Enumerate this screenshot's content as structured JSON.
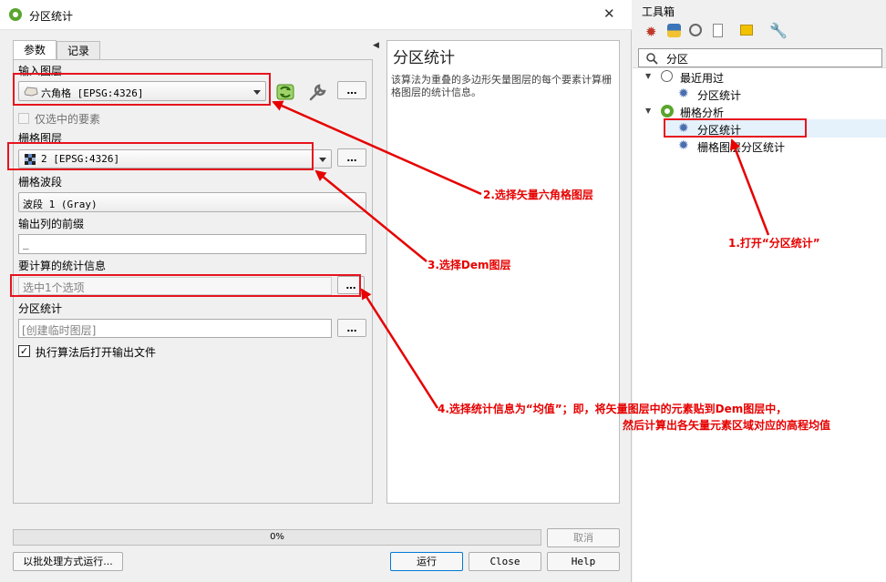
{
  "dialog": {
    "title": "分区统计",
    "close_glyph": "✕",
    "tabs": [
      {
        "label": "参数",
        "active": true
      },
      {
        "label": "记录",
        "active": false
      }
    ],
    "params": {
      "input_layer_label": "输入图层",
      "input_layer_value": "六角格 [EPSG:4326]",
      "selected_only_label": "仅选中的要素",
      "selected_only_checked": false,
      "raster_layer_label": "栅格图层",
      "raster_layer_value": "2 [EPSG:4326]",
      "raster_band_label": "栅格波段",
      "raster_band_value": "波段 1 (Gray)",
      "prefix_label": "输出列的前缀",
      "prefix_value": "_",
      "stats_label": "要计算的统计信息",
      "stats_placeholder": "选中1个选项",
      "zonal_label": "分区统计",
      "zonal_placeholder": "[创建临时图层]",
      "open_after_label": "执行算法后打开输出文件",
      "open_after_checked": true,
      "more_glyph": "…"
    },
    "help": {
      "title": "分区统计",
      "text": "该算法为重叠的多边形矢量图层的每个要素计算栅格图层的统计信息。"
    },
    "progress": {
      "value": 0,
      "text": "0%"
    },
    "buttons": {
      "cancel": "取消",
      "batch": "以批处理方式运行...",
      "run": "运行",
      "close": "Close",
      "help": "Help"
    }
  },
  "annotations": {
    "step1": "1.打开“分区统计”",
    "step2": "2.选择矢量六角格图层",
    "step3": "3.选择Dem图层",
    "step4_line1": "4.选择统计信息为“均值”；即，将矢量图层中的元素贴到Dem图层中，",
    "step4_line2": "然后计算出各矢量元素区域对应的高程均值",
    "color": "#e60000"
  },
  "toolbox": {
    "title": "工具箱",
    "search_value": "分区",
    "tree": [
      {
        "label": "最近用过",
        "type": "group",
        "icon": "clock-icon"
      },
      {
        "label": "分区统计",
        "type": "item",
        "icon": "gear-icon"
      },
      {
        "label": "栅格分析",
        "type": "group",
        "icon": "qgis-icon"
      },
      {
        "label": "分区统计",
        "type": "item",
        "icon": "gear-icon"
      },
      {
        "label": "栅格图层分区统计",
        "type": "item",
        "icon": "gear-icon"
      }
    ]
  }
}
